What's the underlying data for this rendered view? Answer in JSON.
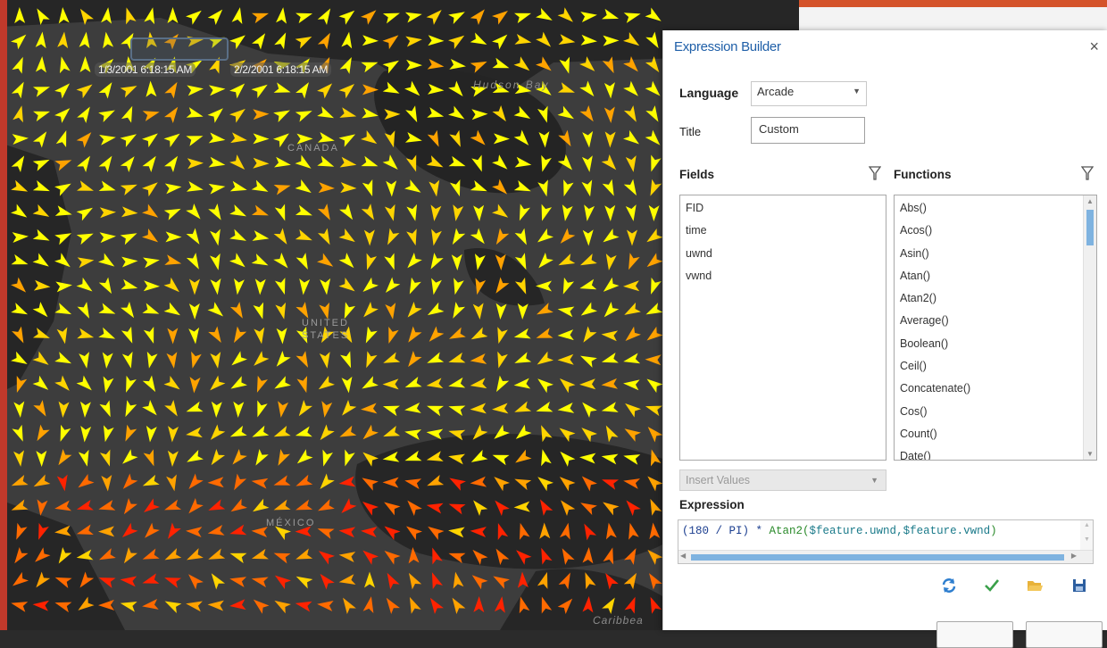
{
  "map": {
    "time_start": "1/3/2001 6:18:15 AM",
    "time_end": "2/2/2001 6:18:15 AM",
    "labels": {
      "hudson_bay": "Hudson Bay",
      "canada": "CANADA",
      "united_states": "UNITED STATES",
      "mexico": "MÉXICO",
      "caribbean": "Caribbea"
    },
    "arrow_colors": [
      "#ffff00",
      "#ffd400",
      "#ffa200",
      "#ff6a00",
      "#ff2200"
    ]
  },
  "dialog": {
    "title": "Expression Builder",
    "close_glyph": "×",
    "language_label": "Language",
    "language_value": "Arcade",
    "title_label": "Title",
    "title_value": "Custom",
    "fields_label": "Fields",
    "functions_label": "Functions",
    "fields": [
      "FID",
      "time",
      "uwnd",
      "vwnd"
    ],
    "functions": [
      "Abs()",
      "Acos()",
      "Asin()",
      "Atan()",
      "Atan2()",
      "Average()",
      "Boolean()",
      "Ceil()",
      "Concatenate()",
      "Cos()",
      "Count()",
      "Date()"
    ],
    "insert_values_label": "Insert Values",
    "expression_label": "Expression",
    "expression": {
      "part1": "(180 / PI) * ",
      "part2": "Atan2(",
      "part3": "$feature.uwnd,$feature.vwnd",
      "part4": ")"
    },
    "colors": {
      "accent": "#1f5fa8",
      "verify": "#3aa04a",
      "refresh": "#2f7fcf",
      "folder": "#e8b23a",
      "save": "#2d5fa0"
    }
  }
}
